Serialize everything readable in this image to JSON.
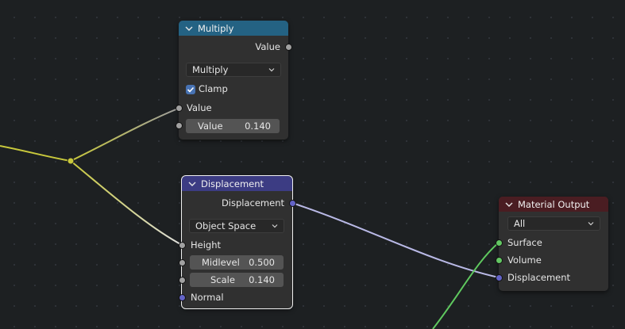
{
  "colors": {
    "canvas": "#1d2022",
    "node_body": "#303030",
    "header_converter": "#246283",
    "header_vector": "#3c3c83",
    "header_output": "#4a1d22",
    "socket_float": "#a1a1a1",
    "socket_vector": "#6363c7",
    "socket_shader": "#63c763",
    "wire_yellow": "#c8c83c",
    "checkbox": "#4772b3"
  },
  "nodes": {
    "multiply": {
      "title": "Multiply",
      "output_label": "Value",
      "operation": "Multiply",
      "clamp_label": "Clamp",
      "clamp_checked": true,
      "input_label": "Value",
      "value_field_label": "Value",
      "value_field_value": "0.140"
    },
    "displacement": {
      "title": "Displacement",
      "output_label": "Displacement",
      "space": "Object Space",
      "height_label": "Height",
      "midlevel_label": "Midlevel",
      "midlevel_value": "0.500",
      "scale_label": "Scale",
      "scale_value": "0.140",
      "normal_label": "Normal"
    },
    "material_output": {
      "title": "Material Output",
      "target": "All",
      "surface_label": "Surface",
      "volume_label": "Volume",
      "displacement_label": "Displacement"
    }
  }
}
